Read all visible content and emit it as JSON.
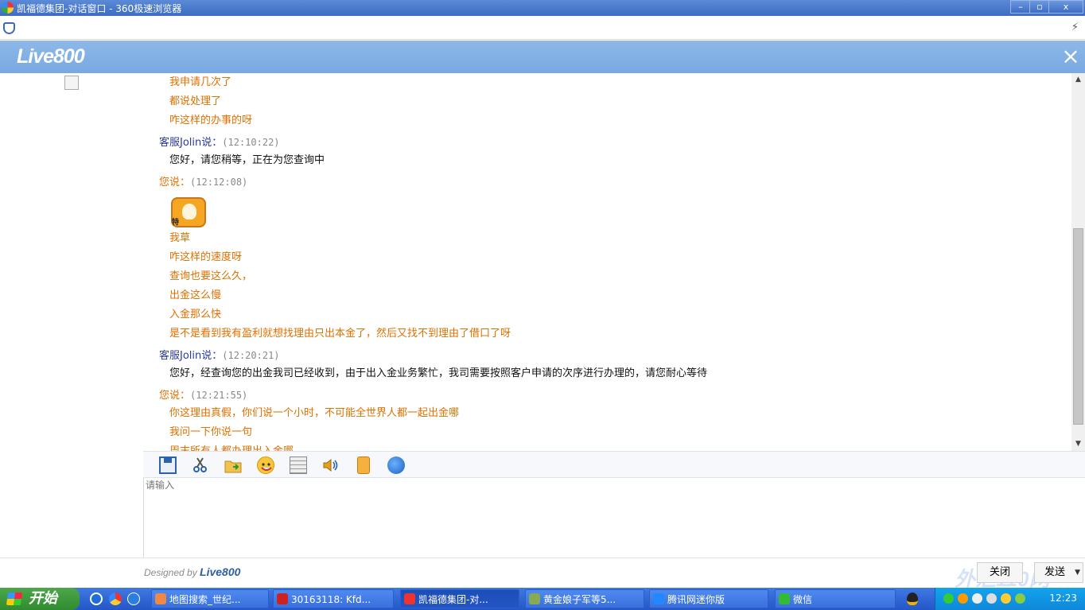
{
  "window": {
    "title": "凯福德集团-对话窗口 - 360极速浏览器",
    "minimize": "–",
    "maximize": "▫",
    "close": "x"
  },
  "browser": {
    "bolt": "⚡"
  },
  "header": {
    "logo": "Live800",
    "close": "×"
  },
  "messages": [
    {
      "kind": "mine-line",
      "text": "我申请几次了"
    },
    {
      "kind": "mine-line",
      "text": "都说处理了"
    },
    {
      "kind": "mine-line",
      "text": "咋这样的办事的呀"
    },
    {
      "kind": "agent-header",
      "speaker": "客服Jolin说：",
      "time": "(12:10:22)"
    },
    {
      "kind": "agent-line",
      "text": "您好，请您稍等，正在为您查询中"
    },
    {
      "kind": "mine-header",
      "speaker": "您说：",
      "time": "(12:12:08)"
    },
    {
      "kind": "sticker",
      "text": "特"
    },
    {
      "kind": "mine-line",
      "text": "我草"
    },
    {
      "kind": "mine-line",
      "text": "咋这样的速度呀"
    },
    {
      "kind": "mine-line",
      "text": "查询也要这么久，"
    },
    {
      "kind": "mine-line",
      "text": "出金这么慢"
    },
    {
      "kind": "mine-line",
      "text": "入金那么快"
    },
    {
      "kind": "mine-line",
      "text": "是不是看到我有盈利就想找理由只出本金了，然后又找不到理由了借口了呀"
    },
    {
      "kind": "agent-header",
      "speaker": "客服Jolin说：",
      "time": "(12:20:21)"
    },
    {
      "kind": "agent-line",
      "text": "您好，经查询您的出金我司已经收到，由于出入金业务繁忙，我司需要按照客户申请的次序进行办理的，请您耐心等待"
    },
    {
      "kind": "mine-header",
      "speaker": "您说：",
      "time": "(12:21:55)"
    },
    {
      "kind": "mine-line",
      "text": "你这理由真假，你们说一个小时，不可能全世界人都一起出金哪"
    },
    {
      "kind": "mine-line",
      "text": "我问一下你说一句"
    },
    {
      "kind": "mine-line",
      "text": "周末所有人都办理出入金哪"
    }
  ],
  "input": {
    "placeholder": "请输入"
  },
  "footer": {
    "designed_by": "Designed by ",
    "brand": "Live800",
    "close_label": "关闭",
    "send_label": "发送",
    "send_caret": "▼",
    "watermark": "外汇110网"
  },
  "taskbar": {
    "start": "开始",
    "tasks": [
      {
        "label": "地图搜索_世纪...",
        "color": "#e84"
      },
      {
        "label": "30163118: Kfd...",
        "color": "#c22"
      },
      {
        "label": "凯福德集团-对...",
        "color": "#e33"
      },
      {
        "label": "黄金娘子军等5...",
        "color": "#8a5"
      },
      {
        "label": "腾讯网迷你版",
        "color": "#28f"
      },
      {
        "label": "微信",
        "color": "#3b3"
      }
    ],
    "clock": "12:23"
  }
}
